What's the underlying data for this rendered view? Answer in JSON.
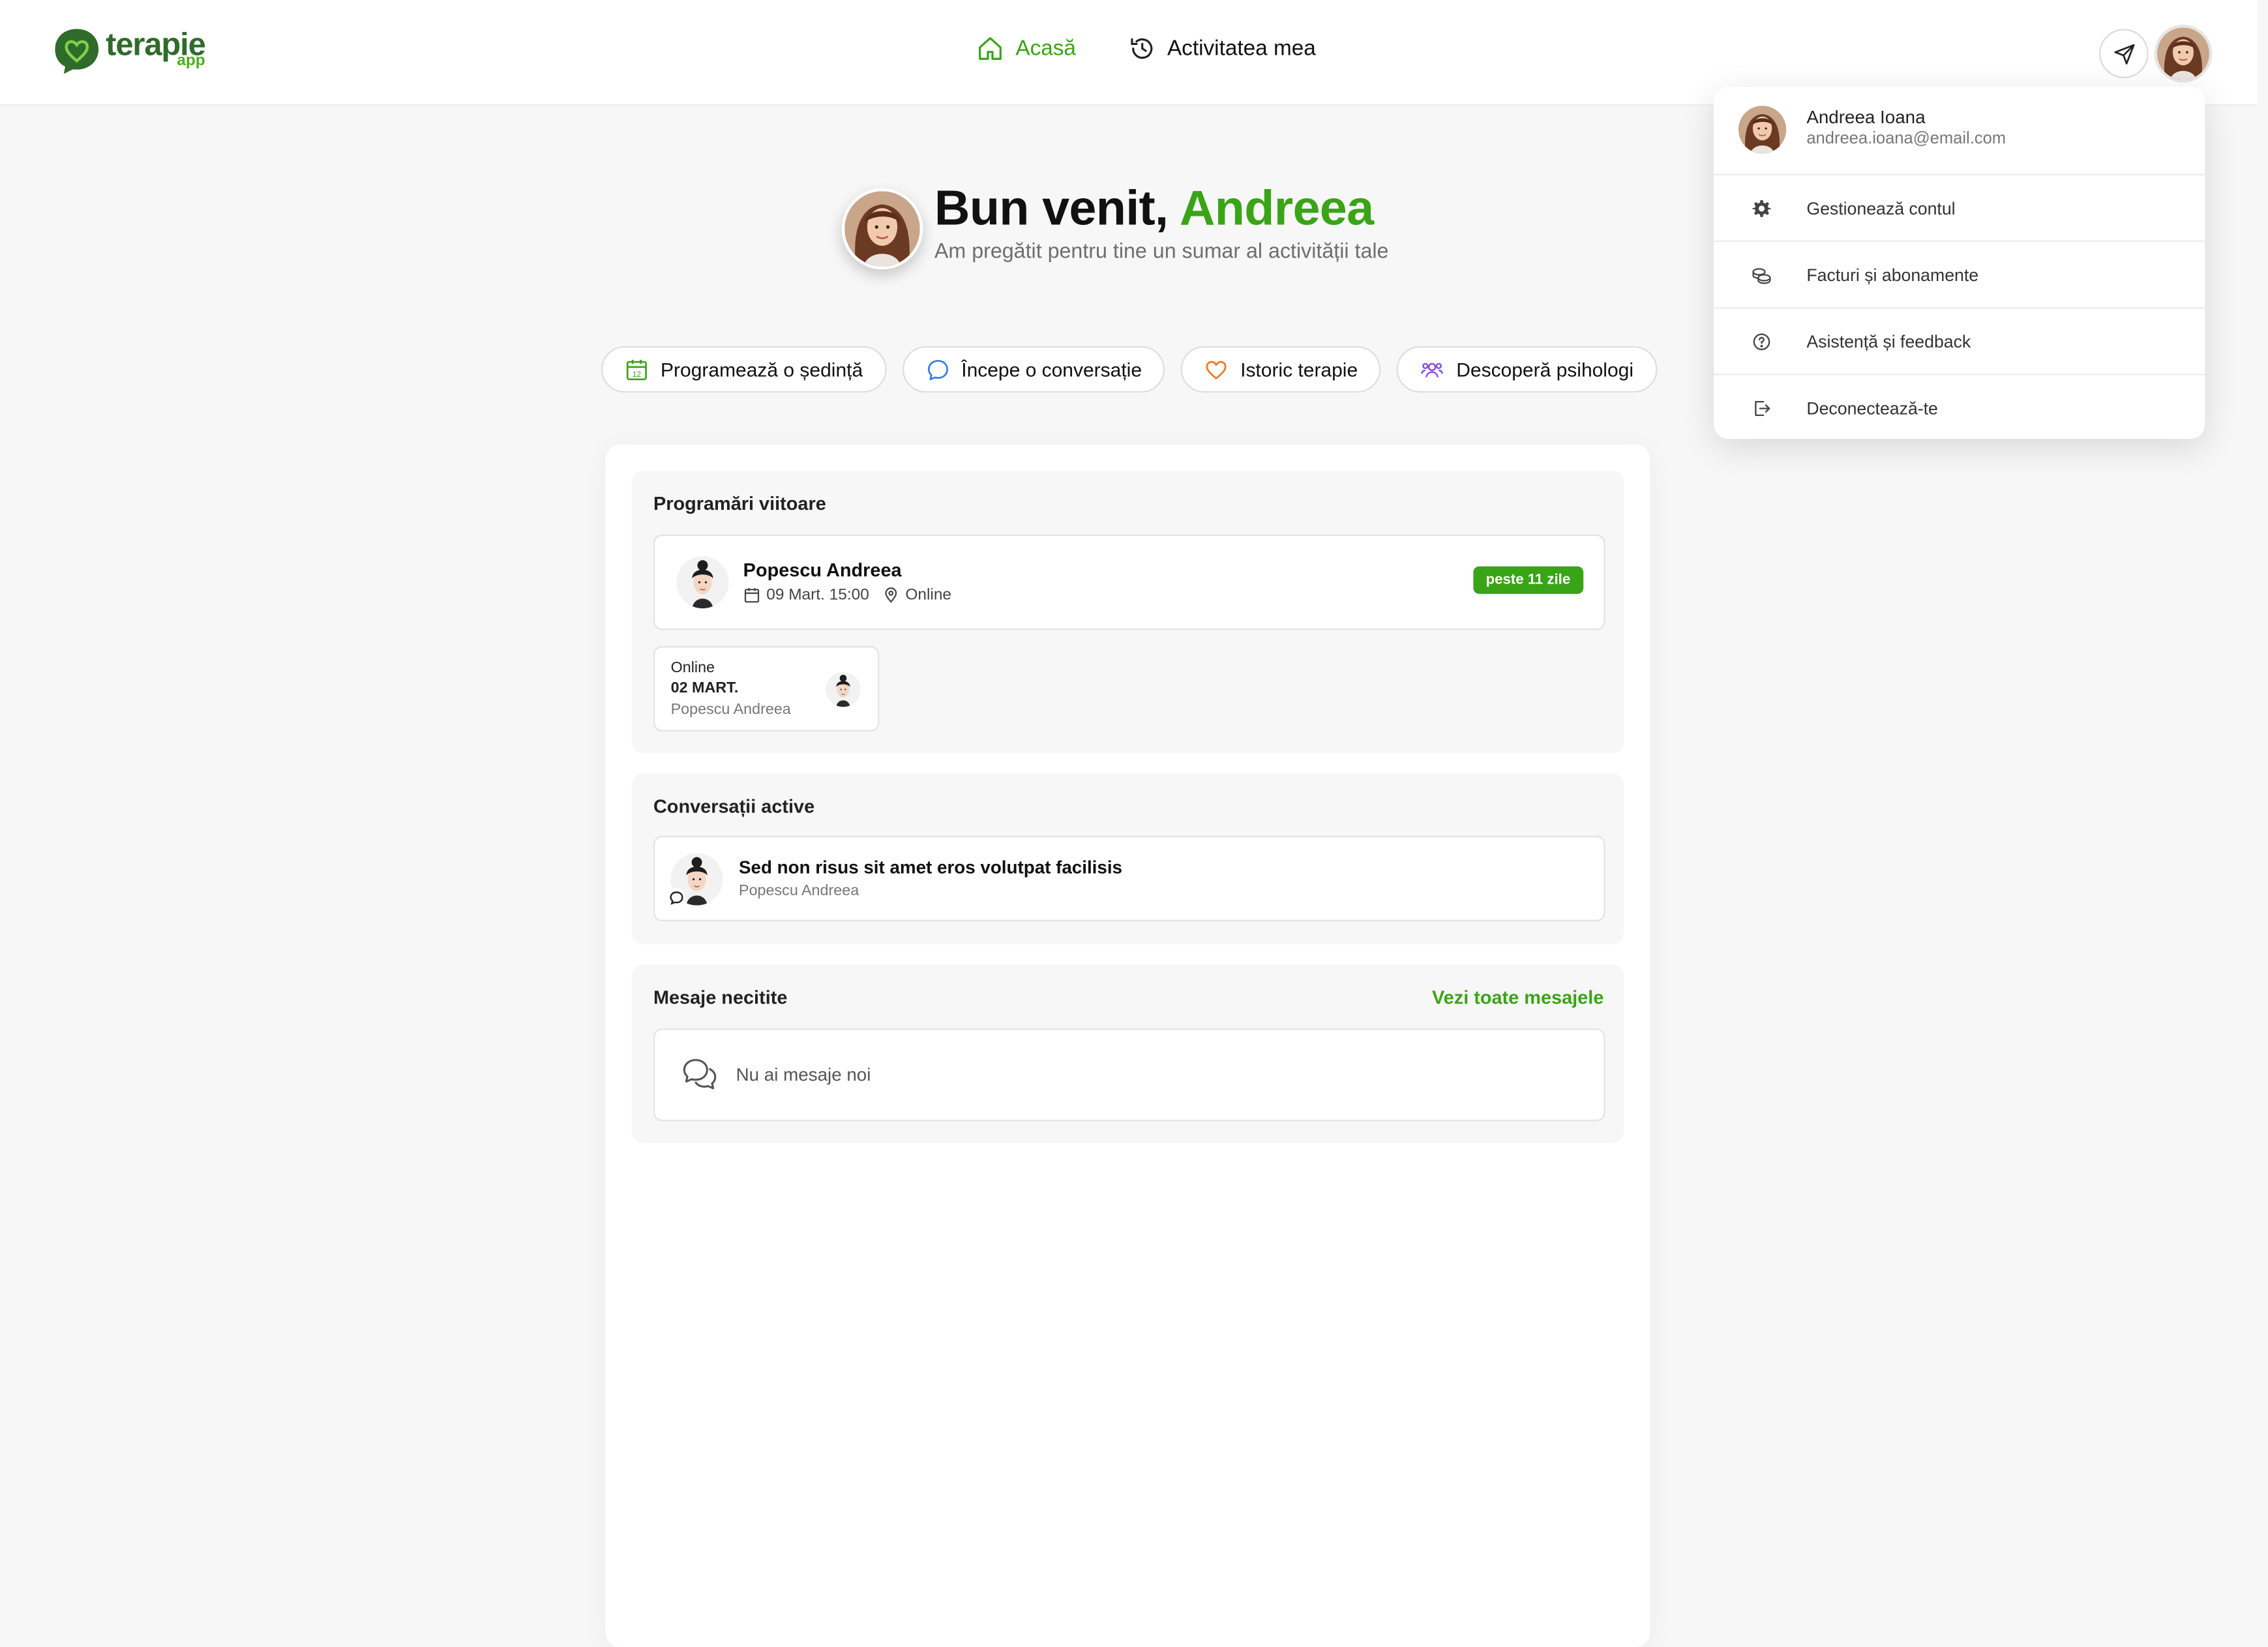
{
  "header": {
    "logo_word": "terapie",
    "logo_sub": "app",
    "nav": [
      {
        "label": "Acasă",
        "active": true
      },
      {
        "label": "Activitatea mea",
        "active": false
      }
    ]
  },
  "welcome": {
    "greeting": "Bun venit,",
    "name": "Andreea",
    "subtitle": "Am pregătit pentru tine un sumar al activității tale"
  },
  "actions": [
    {
      "label": "Programează o ședință",
      "icon": "calendar-icon",
      "color": "#3aa417"
    },
    {
      "label": "Începe o conversație",
      "icon": "chat-bubble-icon",
      "color": "#2f7de1"
    },
    {
      "label": "Istoric terapie",
      "icon": "heart-icon",
      "color": "#f07a24"
    },
    {
      "label": "Descoperă psihologi",
      "icon": "users-icon",
      "color": "#8a4fd8"
    }
  ],
  "upcoming": {
    "title": "Programări viitoare",
    "main": {
      "name": "Popescu Andreea",
      "date": "09 Mart. 15:00",
      "location": "Online",
      "badge": "peste 11 zile"
    },
    "mini": {
      "type": "Online",
      "date": "02 MART.",
      "name": "Popescu Andreea"
    }
  },
  "conversations": {
    "title": "Conversații active",
    "items": [
      {
        "title": "Sed non risus sit amet eros volutpat facilisis",
        "name": "Popescu Andreea"
      }
    ]
  },
  "messages": {
    "title": "Mesaje necitite",
    "see_all": "Vezi toate mesajele",
    "empty": "Nu ai mesaje noi"
  },
  "dropdown": {
    "user_name": "Andreea Ioana",
    "user_email": "andreea.ioana@email.com",
    "items": [
      {
        "label": "Gestionează contul",
        "icon": "gear-icon"
      },
      {
        "label": "Facturi și abonamente",
        "icon": "coins-icon"
      },
      {
        "label": "Asistență și feedback",
        "icon": "help-circle-icon"
      },
      {
        "label": "Deconectează-te",
        "icon": "logout-icon"
      }
    ]
  },
  "colors": {
    "accent": "#3aa417",
    "brand_dark": "#2f6b2a"
  }
}
